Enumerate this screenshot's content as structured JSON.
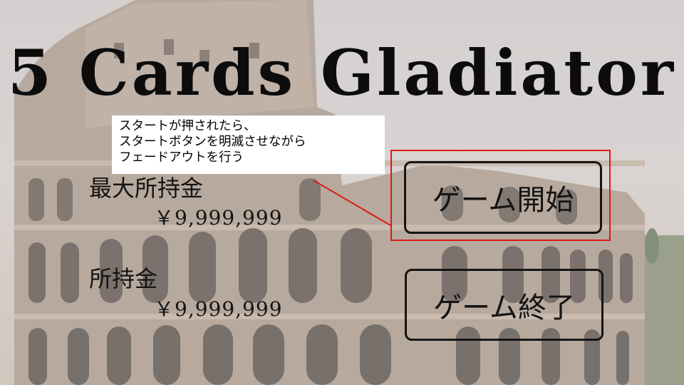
{
  "title": "5 Cards Gladiator",
  "annotation": {
    "lines": [
      "スタートが押されたら、",
      "スタートボタンを明滅させながら",
      "フェードアウトを行う"
    ],
    "highlight_color": "#e01818"
  },
  "stats": {
    "max_money_label": "最大所持金",
    "max_money_value": "￥9,999,999",
    "money_label": "所持金",
    "money_value": "￥9,999,999"
  },
  "buttons": {
    "start": "ゲーム開始",
    "quit": "ゲーム終了"
  },
  "background": "colosseum"
}
